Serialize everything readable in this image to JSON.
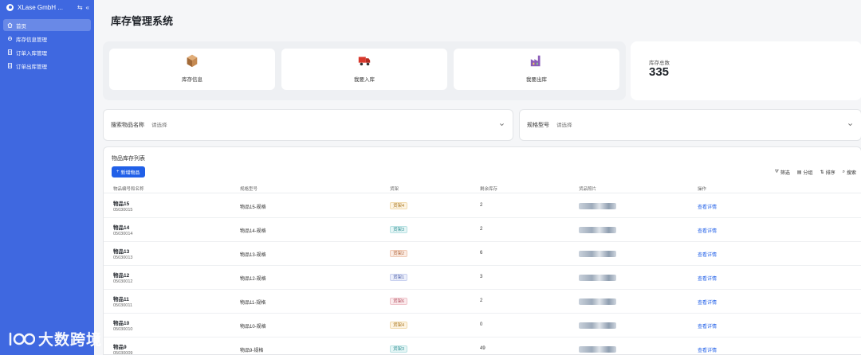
{
  "sidebar": {
    "company": "XLase GmbH ...",
    "items": [
      {
        "label": "首页",
        "icon": "home-icon",
        "active": true
      },
      {
        "label": "库存信息管理",
        "icon": "settings-icon",
        "active": false
      },
      {
        "label": "订单入库管理",
        "icon": "document-icon",
        "active": false
      },
      {
        "label": "订单出库管理",
        "icon": "document-icon",
        "active": false
      }
    ]
  },
  "page_title": "库存管理系统",
  "quick_cards": [
    {
      "label": "库存信息",
      "icon": "box-icon"
    },
    {
      "label": "我要入库",
      "icon": "truck-icon"
    },
    {
      "label": "我要出库",
      "icon": "factory-icon"
    }
  ],
  "stats": {
    "label": "库存总数",
    "value": "335"
  },
  "filters": {
    "name": {
      "label": "搜索物品名称",
      "placeholder": "请选择"
    },
    "spec": {
      "label": "规格型号",
      "placeholder": "请选择"
    }
  },
  "table": {
    "title": "物品库存列表",
    "add_label": "新增物品",
    "tools": [
      {
        "label": "筛选",
        "icon": "filter-icon"
      },
      {
        "label": "分组",
        "icon": "group-icon"
      },
      {
        "label": "排序",
        "icon": "sort-icon"
      },
      {
        "label": "搜索",
        "icon": "search-icon"
      }
    ],
    "columns": [
      "物品编号和名称",
      "规格型号",
      "货架",
      "剩余库存",
      "货品照片",
      "操作"
    ],
    "action_label": "查看详情",
    "rows": [
      {
        "name": "物品15",
        "code": "05030015",
        "spec": "物品15-规格",
        "shelf": "货架4",
        "shelf_color": "s4",
        "stock": "2"
      },
      {
        "name": "物品14",
        "code": "05030014",
        "spec": "物品14-规格",
        "shelf": "货架3",
        "shelf_color": "s3",
        "stock": "2"
      },
      {
        "name": "物品13",
        "code": "05030013",
        "spec": "物品13-规格",
        "shelf": "货架2",
        "shelf_color": "s2",
        "stock": "6"
      },
      {
        "name": "物品12",
        "code": "05030012",
        "spec": "物品12-规格",
        "shelf": "货架1",
        "shelf_color": "s1",
        "stock": "3"
      },
      {
        "name": "物品11",
        "code": "05030011",
        "spec": "物品11-规格",
        "shelf": "货架6",
        "shelf_color": "s6",
        "stock": "2"
      },
      {
        "name": "物品10",
        "code": "05030010",
        "spec": "物品10-规格",
        "shelf": "货架4",
        "shelf_color": "s4",
        "stock": "0"
      },
      {
        "name": "物品9",
        "code": "05030009",
        "spec": "物品9-规格",
        "shelf": "货架3",
        "shelf_color": "s3",
        "stock": "49"
      }
    ]
  },
  "watermark": "大数跨境"
}
